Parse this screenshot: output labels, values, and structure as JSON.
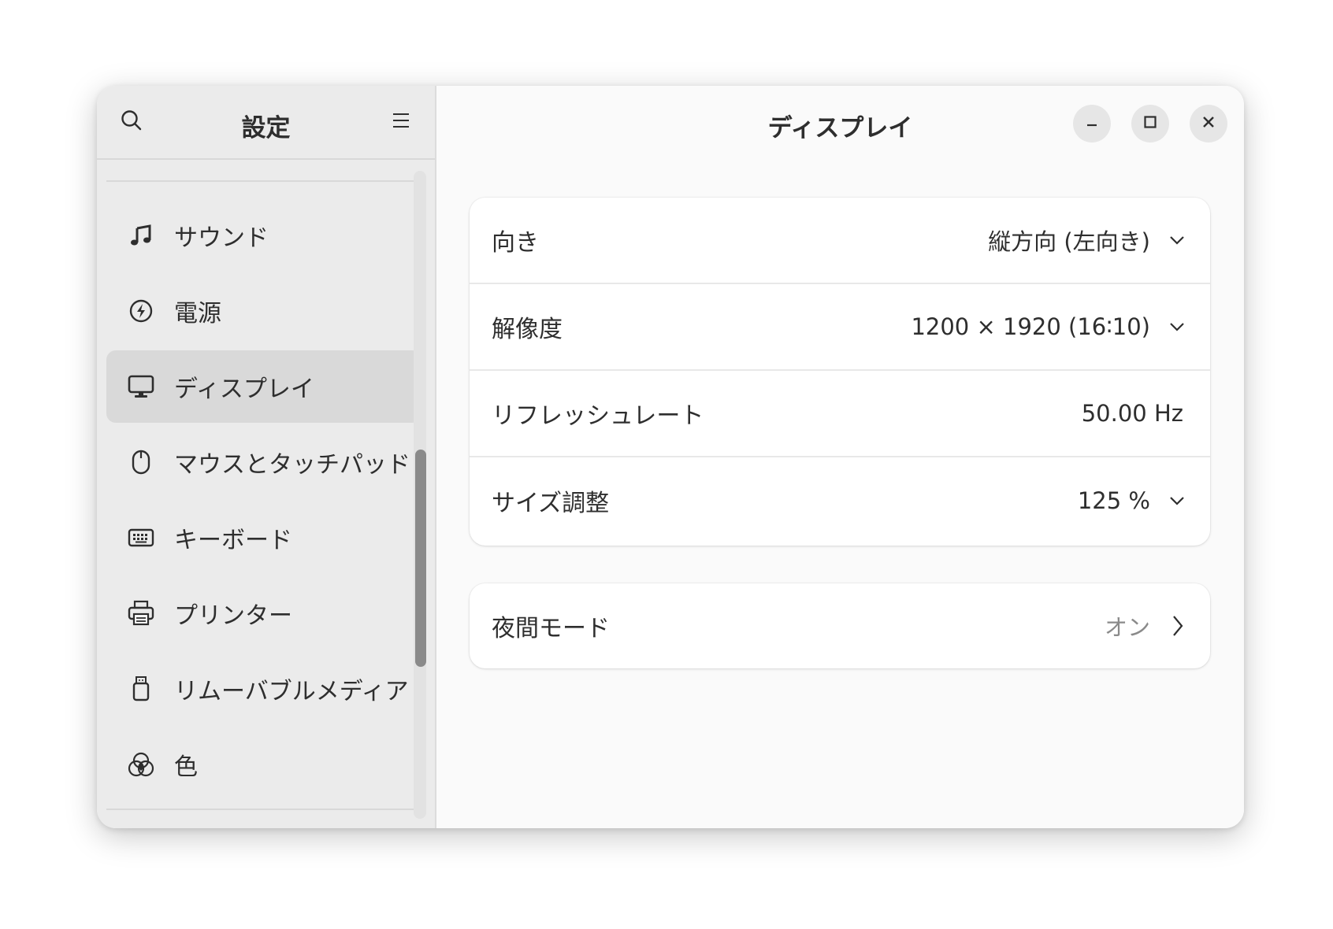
{
  "sidebar": {
    "title": "設定",
    "items": [
      {
        "label": "サウンド",
        "icon": "music-note-icon"
      },
      {
        "label": "電源",
        "icon": "power-icon"
      },
      {
        "label": "ディスプレイ",
        "icon": "monitor-icon",
        "selected": true
      },
      {
        "label": "マウスとタッチパッド",
        "icon": "mouse-icon"
      },
      {
        "label": "キーボード",
        "icon": "keyboard-icon"
      },
      {
        "label": "プリンター",
        "icon": "printer-icon"
      },
      {
        "label": "リムーバブルメディア",
        "icon": "usb-drive-icon"
      },
      {
        "label": "色",
        "icon": "color-icon"
      }
    ]
  },
  "main": {
    "title": "ディスプレイ",
    "settings": [
      {
        "label": "向き",
        "value": "縦方向 (左向き)",
        "control": "dropdown"
      },
      {
        "label": "解像度",
        "value": "1200 × 1920 (16∶10)",
        "control": "dropdown"
      },
      {
        "label": "リフレッシュレート",
        "value": "50.00 Hz",
        "control": "none"
      },
      {
        "label": "サイズ調整",
        "value": "125 %",
        "control": "dropdown"
      }
    ],
    "night_mode": {
      "label": "夜間モード",
      "value": "オン"
    }
  },
  "colors": {
    "sidebar_bg": "#ebebeb",
    "selected_item": "#d9d9d9",
    "main_bg": "#fafafa",
    "card_bg": "#ffffff",
    "text": "#2e2e2e",
    "dim_text": "#8a8a8a"
  }
}
